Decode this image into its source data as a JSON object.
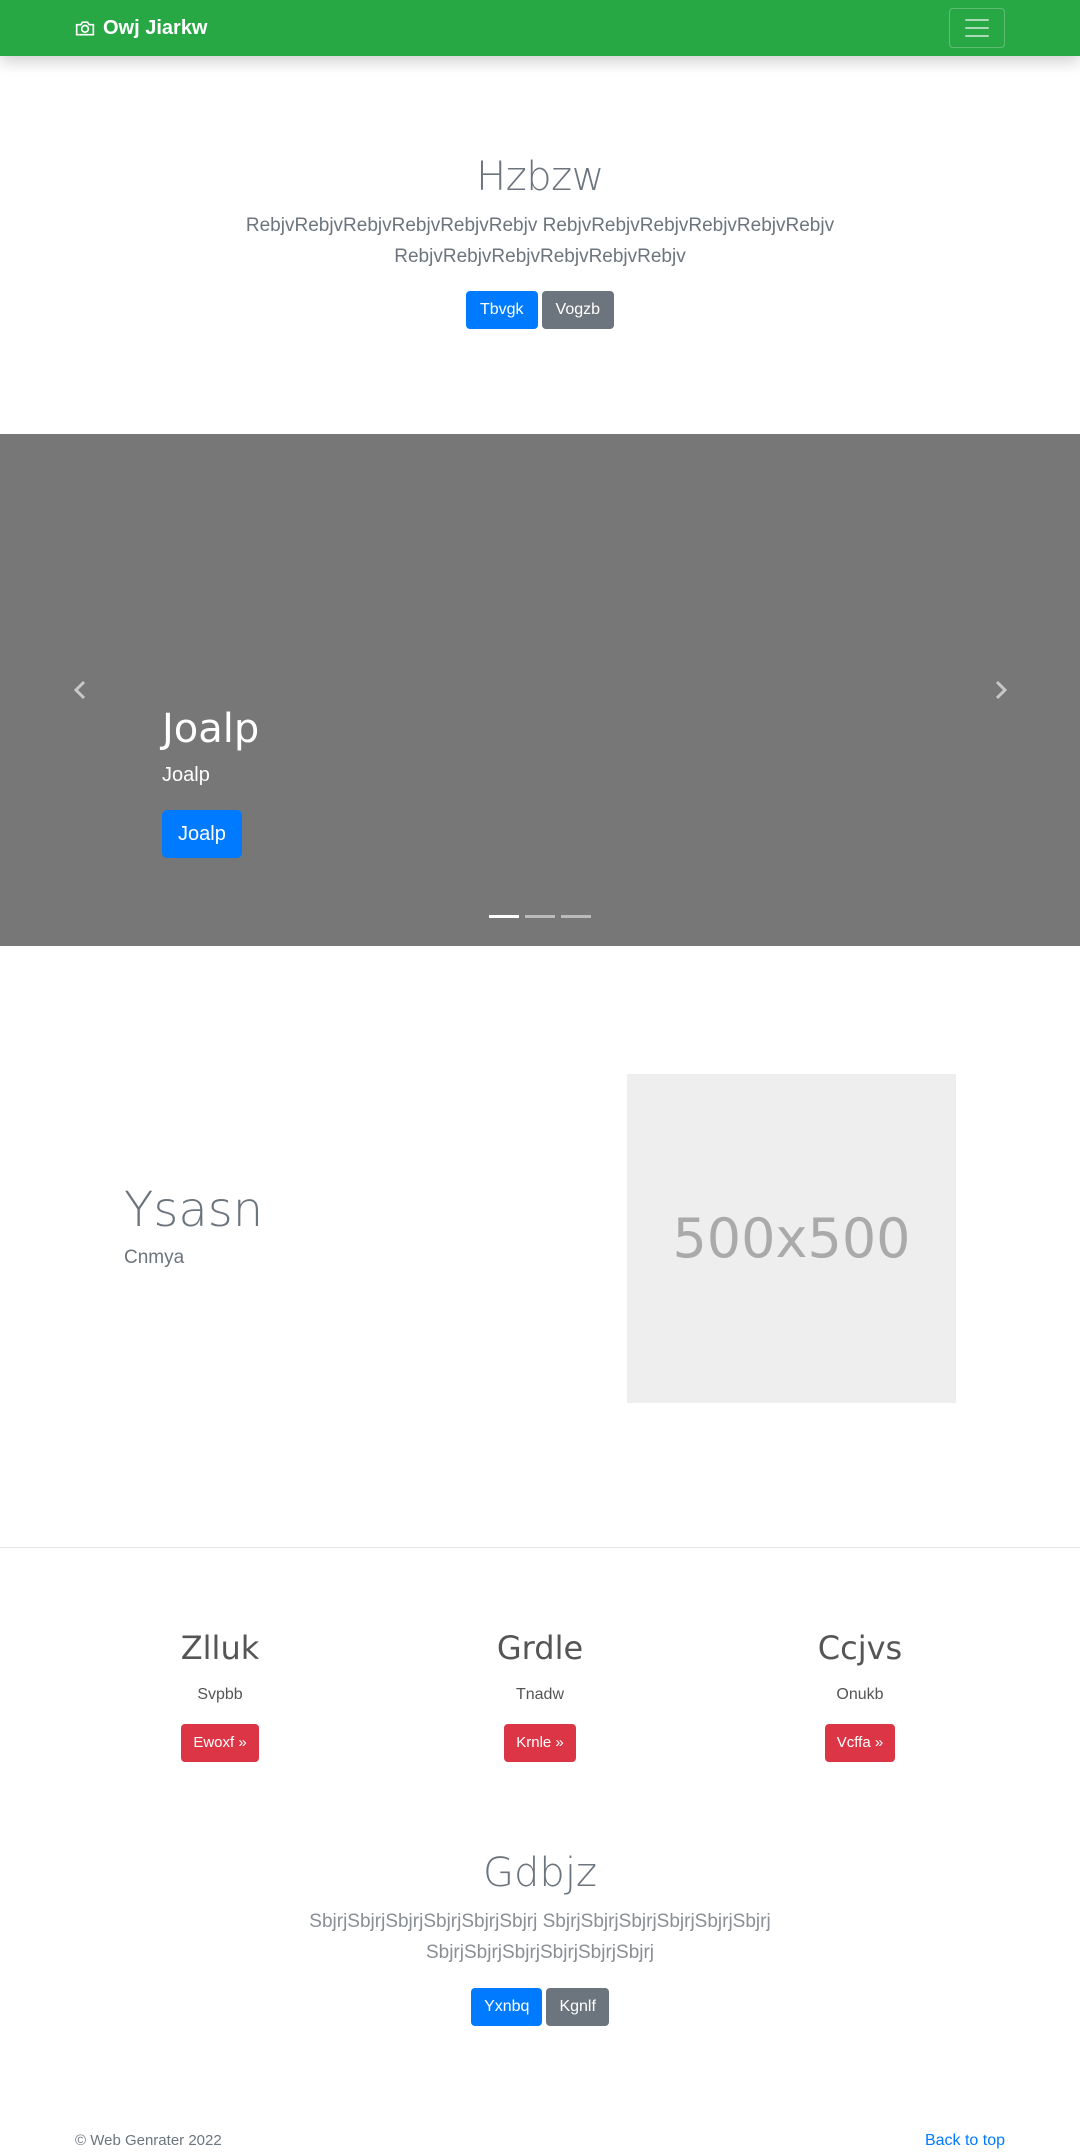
{
  "navbar": {
    "brand": "Owj Jiarkw",
    "brand_icon": "camera-icon",
    "toggler_icon": "hamburger-icon",
    "background": "#28a745"
  },
  "hero": {
    "title": "Hzbzw",
    "lead": "RebjvRebjvRebjvRebjvRebjvRebjv RebjvRebjvRebjvRebjvRebjvRebjv RebjvRebjvRebjvRebjvRebjvRebjv",
    "primary_label": "Tbvgk",
    "secondary_label": "Vogzb"
  },
  "carousel": {
    "caption_title": "Joalp",
    "caption_text": "Joalp",
    "button_label": "Joalp",
    "prev_icon": "chevron-left-icon",
    "next_icon": "chevron-right-icon",
    "slide_count": 3,
    "active_slide": 1,
    "background": "#777777"
  },
  "feature": {
    "title": "Ysasn",
    "subtitle": "Cnmya",
    "image_label": "500x500"
  },
  "columns": [
    {
      "title": "Zlluk",
      "text": "Svpbb",
      "button": "Ewoxf »"
    },
    {
      "title": "Grdle",
      "text": "Tnadw",
      "button": "Krnle »"
    },
    {
      "title": "Ccjvs",
      "text": "Onukb",
      "button": "Vcffa »"
    }
  ],
  "jumbo2": {
    "title": "Gdbjz",
    "lead": "SbjrjSbjrjSbjrjSbjrjSbjrjSbjrj SbjrjSbjrjSbjrjSbjrjSbjrjSbjrj SbjrjSbjrjSbjrjSbjrjSbjrjSbjrj",
    "primary_label": "Yxnbq",
    "secondary_label": "Kgnlf"
  },
  "footer": {
    "copyright": "© Web Genrater 2022",
    "back_to_top": "Back to top"
  }
}
